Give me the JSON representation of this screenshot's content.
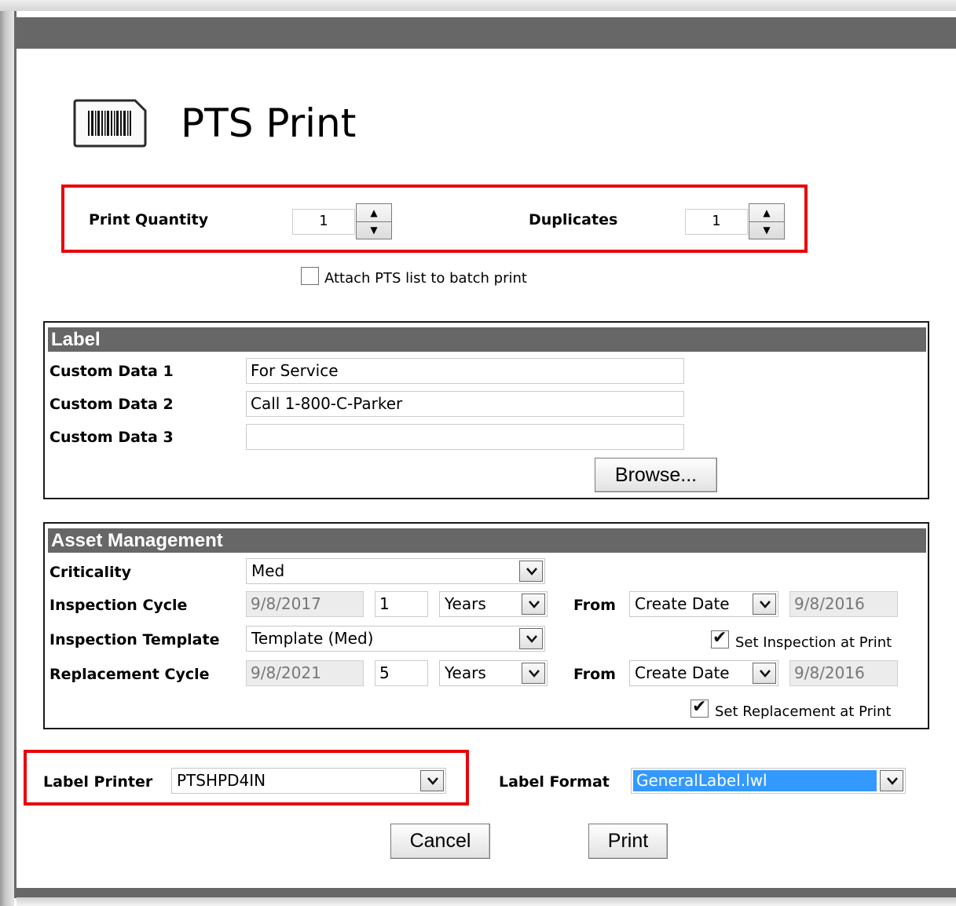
{
  "title": "PTS Print",
  "accent_color": "#e8000b",
  "header_bar_color": "#676767",
  "quantity": {
    "print_quantity_label": "Print Quantity",
    "print_quantity_value": "1",
    "duplicates_label": "Duplicates",
    "duplicates_value": "1",
    "attach_label": "Attach PTS list to batch print",
    "attach_checked": false
  },
  "label_panel": {
    "header": "Label",
    "custom1_label": "Custom Data 1",
    "custom1_value": "For Service",
    "custom2_label": "Custom Data 2",
    "custom2_value": "Call 1-800-C-Parker",
    "custom3_label": "Custom Data 3",
    "custom3_value": "",
    "browse_label": "Browse..."
  },
  "asset_panel": {
    "header": "Asset Management",
    "criticality_label": "Criticality",
    "criticality_value": "Med",
    "inspection_cycle_label": "Inspection Cycle",
    "inspection_date": "9/8/2017",
    "inspection_count": "1",
    "inspection_unit": "Years",
    "inspection_from_label": "From",
    "inspection_from_value": "Create Date",
    "inspection_from_date": "9/8/2016",
    "inspection_template_label": "Inspection Template",
    "inspection_template_value": "Template (Med)",
    "set_inspection_label": "Set Inspection at Print",
    "set_inspection_checked": true,
    "replacement_cycle_label": "Replacement Cycle",
    "replacement_date": "9/8/2021",
    "replacement_count": "5",
    "replacement_unit": "Years",
    "replacement_from_label": "From",
    "replacement_from_value": "Create Date",
    "replacement_from_date": "9/8/2016",
    "set_replacement_label": "Set Replacement at Print",
    "set_replacement_checked": true
  },
  "printer": {
    "label_printer_label": "Label Printer",
    "label_printer_value": "PTSHPD4IN",
    "label_format_label": "Label Format",
    "label_format_value": "GeneralLabel.lwl",
    "selection_color": "#3399ff"
  },
  "actions": {
    "cancel_label": "Cancel",
    "print_label": "Print"
  },
  "icons": {
    "title_icon": "barcode-label-icon",
    "spin_up": "triangle-up-icon",
    "spin_down": "triangle-down-icon",
    "dropdown": "chevron-down-icon",
    "check": "checkmark-icon"
  }
}
